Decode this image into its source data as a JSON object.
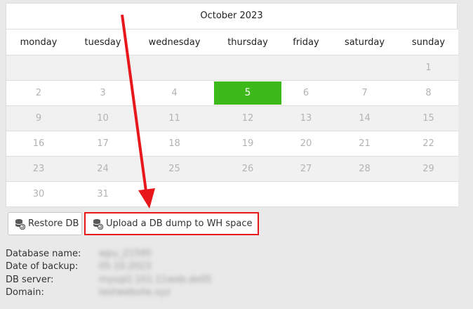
{
  "calendar": {
    "title": "October 2023",
    "weekdays": [
      "monday",
      "tuesday",
      "wednesday",
      "thursday",
      "friday",
      "saturday",
      "sunday"
    ],
    "weeks": [
      [
        "",
        "",
        "",
        "",
        "",
        "",
        "1"
      ],
      [
        "2",
        "3",
        "4",
        "5",
        "6",
        "7",
        "8"
      ],
      [
        "9",
        "10",
        "11",
        "12",
        "13",
        "14",
        "15"
      ],
      [
        "16",
        "17",
        "18",
        "19",
        "20",
        "21",
        "22"
      ],
      [
        "23",
        "24",
        "25",
        "26",
        "27",
        "28",
        "29"
      ],
      [
        "30",
        "31",
        "",
        "",
        "",
        "",
        ""
      ]
    ],
    "selected_day": "5",
    "selected_color": "#3dba1a"
  },
  "buttons": {
    "restore_label": "Restore DB",
    "upload_label": "Upload a DB dump to WH space",
    "icon": "database-restore-icon"
  },
  "annotation": {
    "arrow_color": "#e8171b",
    "highlight_color": "#e8171b"
  },
  "info": [
    {
      "label": "Database name:",
      "value": "wpu_21595"
    },
    {
      "label": "Date of backup:",
      "value": "05.10.2023"
    },
    {
      "label": "DB server:",
      "value": "mysql2.101.11web.de05"
    },
    {
      "label": "Domain:",
      "value": "testwebsite.xyz"
    }
  ]
}
